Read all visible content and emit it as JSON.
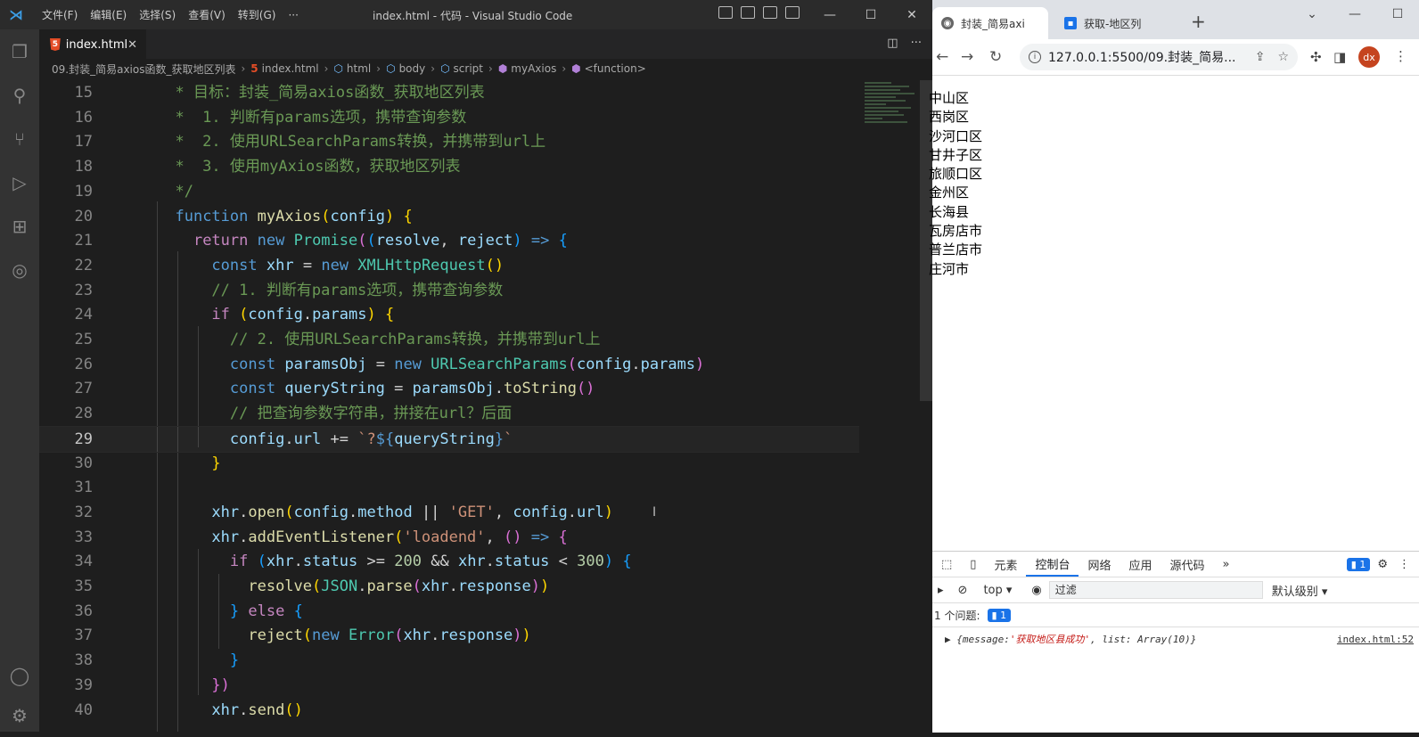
{
  "vscode": {
    "menu": [
      "文件(F)",
      "编辑(E)",
      "选择(S)",
      "查看(V)",
      "转到(G)",
      "···"
    ],
    "window_title": "index.html - 代码 - Visual Studio Code",
    "tab_label": "index.html",
    "breadcrumb": [
      "09.封装_简易axios函数_获取地区列表",
      "index.html",
      "html",
      "body",
      "script",
      "myAxios",
      "<function>"
    ],
    "active_line": 29,
    "code": [
      {
        "n": 15,
        "html": "<span class=\"c\">  * 目标：封装_简易axios函数_获取地区列表</span>"
      },
      {
        "n": 16,
        "html": "<span class=\"c\">  *  1. 判断有params选项，携带查询参数</span>"
      },
      {
        "n": 17,
        "html": "<span class=\"c\">  *  2. 使用URLSearchParams转换，并携带到url上</span>"
      },
      {
        "n": 18,
        "html": "<span class=\"c\">  *  3. 使用myAxios函数，获取地区列表</span>"
      },
      {
        "n": 19,
        "html": "<span class=\"c\">  */</span>"
      },
      {
        "n": 20,
        "html": "  <span class=\"k\">function</span> <span class=\"f\">myAxios</span><span class=\"p1\">(</span><span class=\"v\">config</span><span class=\"p1\">)</span> <span class=\"p1\">{</span>"
      },
      {
        "n": 21,
        "html": "    <span class=\"kc\">return</span> <span class=\"k\">new</span> <span class=\"t\">Promise</span><span class=\"p2\">(</span><span class=\"p3\">(</span><span class=\"v\">resolve</span><span class=\"o\">,</span> <span class=\"v\">reject</span><span class=\"p3\">)</span> <span class=\"k\">=&gt;</span> <span class=\"p3\">{</span>"
      },
      {
        "n": 22,
        "html": "      <span class=\"k\">const</span> <span class=\"v\">xhr</span> <span class=\"o\">=</span> <span class=\"k\">new</span> <span class=\"t\">XMLHttpRequest</span><span class=\"p1\">()</span>"
      },
      {
        "n": 23,
        "html": "      <span class=\"c\">// 1. 判断有params选项，携带查询参数</span>"
      },
      {
        "n": 24,
        "html": "      <span class=\"kc\">if</span> <span class=\"p1\">(</span><span class=\"v\">config</span><span class=\"o\">.</span><span class=\"v\">params</span><span class=\"p1\">)</span> <span class=\"p1\">{</span>"
      },
      {
        "n": 25,
        "html": "        <span class=\"c\">// 2. 使用URLSearchParams转换，并携带到url上</span>"
      },
      {
        "n": 26,
        "html": "        <span class=\"k\">const</span> <span class=\"v\">paramsObj</span> <span class=\"o\">=</span> <span class=\"k\">new</span> <span class=\"t\">URLSearchParams</span><span class=\"p2\">(</span><span class=\"v\">config</span><span class=\"o\">.</span><span class=\"v\">params</span><span class=\"p2\">)</span>"
      },
      {
        "n": 27,
        "html": "        <span class=\"k\">const</span> <span class=\"v\">queryString</span> <span class=\"o\">=</span> <span class=\"v\">paramsObj</span><span class=\"o\">.</span><span class=\"f\">toString</span><span class=\"p2\">()</span>"
      },
      {
        "n": 28,
        "html": "        <span class=\"c\">// 把查询参数字符串，拼接在url？后面</span>"
      },
      {
        "n": 29,
        "html": "        <span class=\"v\">config</span><span class=\"o\">.</span><span class=\"v\">url</span> <span class=\"o\">+=</span> <span class=\"s\">`?</span><span class=\"k\">${</span><span class=\"v\">queryString</span><span class=\"k\">}</span><span class=\"s\">`</span>"
      },
      {
        "n": 30,
        "html": "      <span class=\"p1\">}</span>"
      },
      {
        "n": 31,
        "html": ""
      },
      {
        "n": 32,
        "html": "      <span class=\"v\">xhr</span><span class=\"o\">.</span><span class=\"f\">open</span><span class=\"p1\">(</span><span class=\"v\">config</span><span class=\"o\">.</span><span class=\"v\">method</span> <span class=\"o\">||</span> <span class=\"s\">'GET'</span><span class=\"o\">,</span> <span class=\"v\">config</span><span class=\"o\">.</span><span class=\"v\">url</span><span class=\"p1\">)</span>"
      },
      {
        "n": 33,
        "html": "      <span class=\"v\">xhr</span><span class=\"o\">.</span><span class=\"f\">addEventListener</span><span class=\"p1\">(</span><span class=\"s\">'loadend'</span><span class=\"o\">,</span> <span class=\"p2\">()</span> <span class=\"k\">=&gt;</span> <span class=\"p2\">{</span>"
      },
      {
        "n": 34,
        "html": "        <span class=\"kc\">if</span> <span class=\"p3\">(</span><span class=\"v\">xhr</span><span class=\"o\">.</span><span class=\"v\">status</span> <span class=\"o\">&gt;=</span> <span class=\"n\">200</span> <span class=\"o\">&amp;&amp;</span> <span class=\"v\">xhr</span><span class=\"o\">.</span><span class=\"v\">status</span> <span class=\"o\">&lt;</span> <span class=\"n\">300</span><span class=\"p3\">)</span> <span class=\"p3\">{</span>"
      },
      {
        "n": 35,
        "html": "          <span class=\"f\">resolve</span><span class=\"p1\">(</span><span class=\"t\">JSON</span><span class=\"o\">.</span><span class=\"f\">parse</span><span class=\"p2\">(</span><span class=\"v\">xhr</span><span class=\"o\">.</span><span class=\"v\">response</span><span class=\"p2\">)</span><span class=\"p1\">)</span>"
      },
      {
        "n": 36,
        "html": "        <span class=\"p3\">}</span> <span class=\"kc\">else</span> <span class=\"p3\">{</span>"
      },
      {
        "n": 37,
        "html": "          <span class=\"f\">reject</span><span class=\"p1\">(</span><span class=\"k\">new</span> <span class=\"t\">Error</span><span class=\"p2\">(</span><span class=\"v\">xhr</span><span class=\"o\">.</span><span class=\"v\">response</span><span class=\"p2\">)</span><span class=\"p1\">)</span>"
      },
      {
        "n": 38,
        "html": "        <span class=\"p3\">}</span>"
      },
      {
        "n": 39,
        "html": "      <span class=\"p2\">})</span>"
      },
      {
        "n": 40,
        "html": "      <span class=\"v\">xhr</span><span class=\"o\">.</span><span class=\"f\">send</span><span class=\"p1\">()</span>"
      }
    ]
  },
  "browser": {
    "tabs": [
      "封装_简易axi",
      "获取-地区列"
    ],
    "new_tab": "+",
    "url": "127.0.0.1:5500/09.封装_简易...",
    "avatar": "dx",
    "regions": [
      "中山区",
      "西岗区",
      "沙河口区",
      "甘井子区",
      "旅顺口区",
      "金州区",
      "长海县",
      "瓦房店市",
      "普兰店市",
      "庄河市"
    ],
    "devtools": {
      "tabs": [
        "元素",
        "控制台",
        "网络",
        "应用",
        "源代码"
      ],
      "active_tab": "控制台",
      "more": "»",
      "issue_badge": "1",
      "context": "top ▾",
      "filter_placeholder": "过滤",
      "levels": "默认级别 ▾",
      "issues_label": "1 个问题:",
      "issues_count": "1",
      "log_prefix": "▶ {message: ",
      "log_message": "'获取地区县成功'",
      "log_suffix": ", list: Array(10)}",
      "log_source": "index.html:52"
    }
  },
  "colors": {
    "editor_bg": "#1e1e1e",
    "comment": "#6a9955",
    "keyword": "#569cd6",
    "accent": "#1a73e8"
  }
}
